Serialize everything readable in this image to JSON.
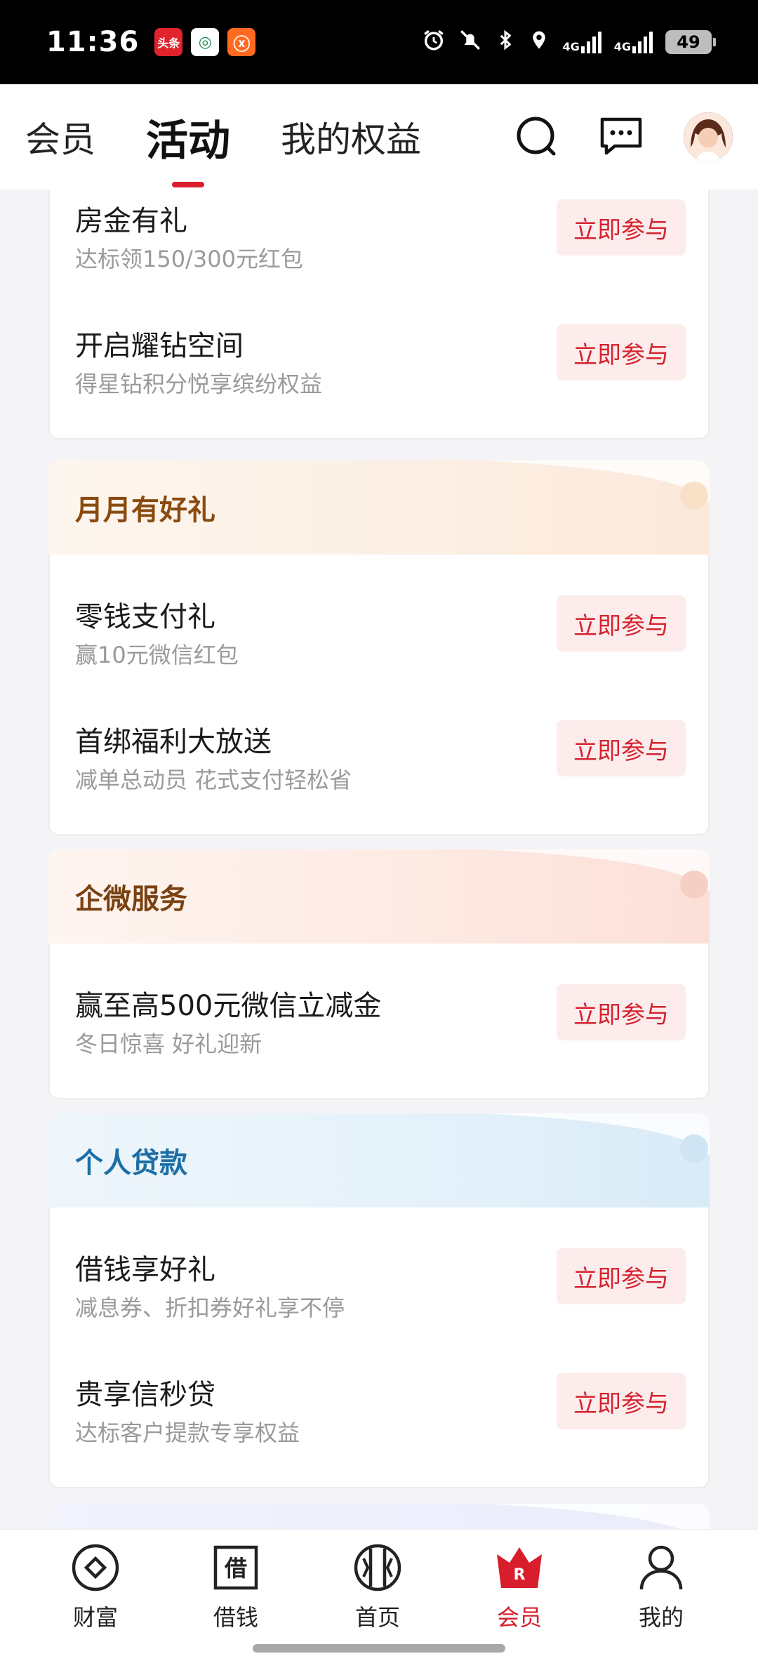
{
  "status_bar": {
    "time": "11:36",
    "apps": [
      "头条",
      "◎",
      "ⓧ"
    ],
    "network_1": "4G",
    "network_2": "4G",
    "battery": "49"
  },
  "header": {
    "tabs": [
      {
        "label": "会员",
        "active": false
      },
      {
        "label": "活动",
        "active": true
      },
      {
        "label": "我的权益",
        "active": false
      }
    ],
    "icons": [
      "search-icon",
      "message-icon",
      "avatar"
    ]
  },
  "top_items": [
    {
      "name": "房金有礼",
      "desc": "达标领150/300元红包",
      "button": "立即参与"
    },
    {
      "name": "开启耀钻空间",
      "desc": "得星钻积分悦享缤纷权益",
      "button": "立即参与"
    }
  ],
  "sections": [
    {
      "title": "月月有好礼",
      "theme": "orange",
      "items": [
        {
          "name": "零钱支付礼",
          "desc": "赢10元微信红包",
          "button": "立即参与"
        },
        {
          "name": "首绑福利大放送",
          "desc": "减单总动员 花式支付轻松省",
          "button": "立即参与"
        }
      ]
    },
    {
      "title": "企微服务",
      "theme": "peach",
      "items": [
        {
          "name": "赢至高500元微信立减金",
          "desc": "冬日惊喜 好礼迎新",
          "button": "立即参与"
        }
      ]
    },
    {
      "title": "个人贷款",
      "theme": "blue",
      "items": [
        {
          "name": "借钱享好礼",
          "desc": "减息券、折扣券好礼享不停",
          "button": "立即参与"
        },
        {
          "name": "贵享信秒贷",
          "desc": "达标客户提款专享权益",
          "button": "立即参与"
        }
      ]
    }
  ],
  "bottom_nav": [
    {
      "label": "财富",
      "icon": "wealth-icon",
      "active": false
    },
    {
      "label": "借钱",
      "icon": "borrow-icon",
      "active": false
    },
    {
      "label": "首页",
      "icon": "home-icon",
      "active": false
    },
    {
      "label": "会员",
      "icon": "member-crown-icon",
      "active": true
    },
    {
      "label": "我的",
      "icon": "profile-icon",
      "active": false
    }
  ],
  "colors": {
    "accent": "#d81e2c",
    "button_bg": "#fdecec",
    "button_text": "#d52330"
  }
}
